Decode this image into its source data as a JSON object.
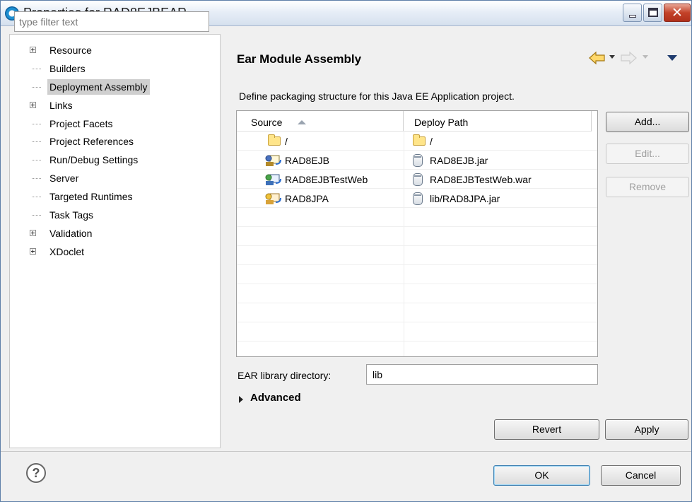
{
  "window": {
    "title": "Properties for RAD8EJBEAR"
  },
  "filter": {
    "placeholder": "type filter text"
  },
  "tree": {
    "items": [
      {
        "label": "Resource",
        "expandable": true
      },
      {
        "label": "Builders",
        "expandable": false
      },
      {
        "label": "Deployment Assembly",
        "expandable": false,
        "selected": true
      },
      {
        "label": "Links",
        "expandable": true
      },
      {
        "label": "Project Facets",
        "expandable": false
      },
      {
        "label": "Project References",
        "expandable": false
      },
      {
        "label": "Run/Debug Settings",
        "expandable": false
      },
      {
        "label": "Server",
        "expandable": false
      },
      {
        "label": "Targeted Runtimes",
        "expandable": false
      },
      {
        "label": "Task Tags",
        "expandable": false
      },
      {
        "label": "Validation",
        "expandable": true
      },
      {
        "label": "XDoclet",
        "expandable": true
      }
    ]
  },
  "page": {
    "title": "Ear Module Assembly",
    "description": "Define packaging structure for this Java EE Application project."
  },
  "table": {
    "columns": [
      "Source",
      "Deploy Path"
    ],
    "rows": [
      {
        "source": "/",
        "source_icon": "folder-icon",
        "deploy": "/",
        "deploy_icon": "folder-icon"
      },
      {
        "source": "RAD8EJB",
        "source_icon": "ejb-project-icon",
        "deploy": "RAD8EJB.jar",
        "deploy_icon": "jar-icon"
      },
      {
        "source": "RAD8EJBTestWeb",
        "source_icon": "web-project-icon",
        "deploy": "RAD8EJBTestWeb.war",
        "deploy_icon": "jar-icon"
      },
      {
        "source": "RAD8JPA",
        "source_icon": "jpa-project-icon",
        "deploy": "lib/RAD8JPA.jar",
        "deploy_icon": "jar-icon"
      }
    ]
  },
  "side_buttons": {
    "add": "Add...",
    "edit": "Edit...",
    "remove": "Remove"
  },
  "library": {
    "label": "EAR library directory:",
    "value": "lib"
  },
  "advanced": {
    "label": "Advanced"
  },
  "footer": {
    "revert": "Revert",
    "apply": "Apply",
    "ok": "OK",
    "cancel": "Cancel",
    "help": "?"
  },
  "colors": {
    "selection": "#cfcfcf",
    "title_gradient_top": "#ffffff",
    "close_button": "#c34229"
  }
}
